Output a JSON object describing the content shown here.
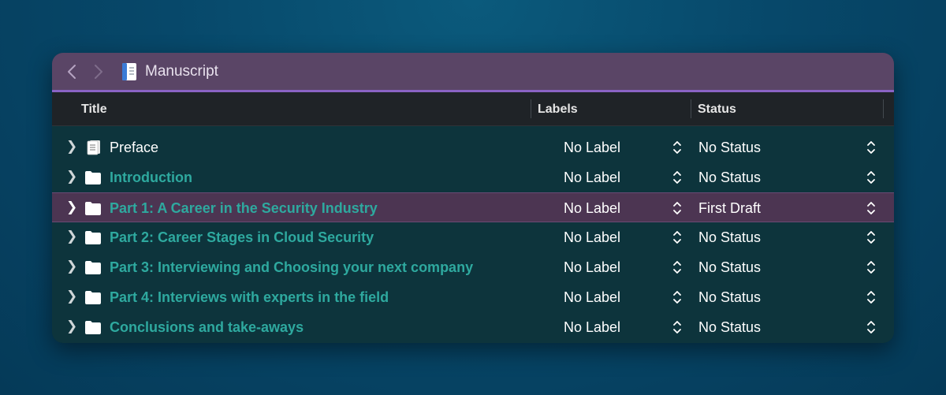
{
  "window": {
    "title": "Manuscript",
    "accent_color": "#8a63c4",
    "titlebar_color": "#5a4566"
  },
  "columns": {
    "title": "Title",
    "labels": "Labels",
    "status": "Status"
  },
  "rows": [
    {
      "title": "Preface",
      "icon": "document-stack-icon",
      "label": "No Label",
      "status": "No Status",
      "selected": false
    },
    {
      "title": "Introduction",
      "icon": "folder-icon",
      "label": "No Label",
      "status": "No Status",
      "selected": false
    },
    {
      "title": "Part 1: A Career in the Security Industry",
      "icon": "folder-icon",
      "label": "No Label",
      "status": "First Draft",
      "selected": true
    },
    {
      "title": "Part 2: Career Stages in Cloud Security",
      "icon": "folder-icon",
      "label": "No Label",
      "status": "No Status",
      "selected": false
    },
    {
      "title": "Part 3: Interviewing and Choosing your next company",
      "icon": "folder-icon",
      "label": "No Label",
      "status": "No Status",
      "selected": false
    },
    {
      "title": "Part 4: Interviews with experts in the field",
      "icon": "folder-icon",
      "label": "No Label",
      "status": "No Status",
      "selected": false
    },
    {
      "title": "Conclusions and take-aways",
      "icon": "folder-icon",
      "label": "No Label",
      "status": "No Status",
      "selected": false
    }
  ]
}
